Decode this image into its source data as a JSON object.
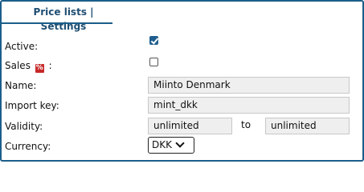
{
  "tab": {
    "label": "Price lists | Settings"
  },
  "form": {
    "active": {
      "label": "Active:",
      "checked": true
    },
    "sales": {
      "label_prefix": "Sales",
      "label_suffix": ":",
      "icon": "percent-icon",
      "checked": false
    },
    "name": {
      "label": "Name:",
      "value": "Miinto Denmark"
    },
    "import_key": {
      "label": "Import key:",
      "value": "mint_dkk"
    },
    "validity": {
      "label": "Validity:",
      "from": "unlimited",
      "to_label": "to",
      "to": "unlimited"
    },
    "currency": {
      "label": "Currency:",
      "value": "DKK"
    }
  },
  "colors": {
    "accent": "#1b5e8a",
    "field_bg": "#efefef",
    "icon_red": "#c62828"
  }
}
